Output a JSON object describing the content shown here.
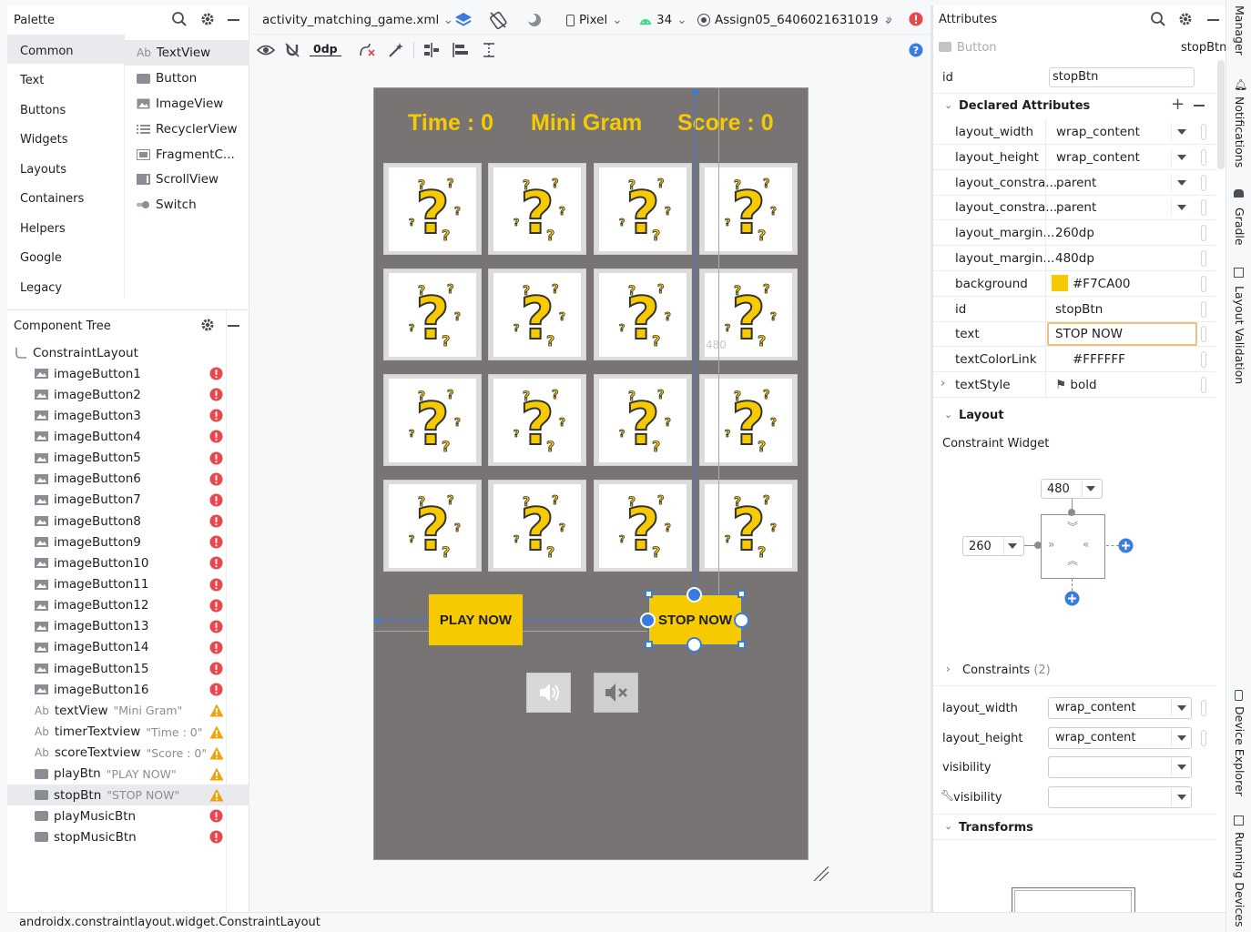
{
  "palette": {
    "title": "Palette",
    "categories": [
      "Common",
      "Text",
      "Buttons",
      "Widgets",
      "Layouts",
      "Containers",
      "Helpers",
      "Google",
      "Legacy"
    ],
    "widgets": [
      "TextView",
      "Button",
      "ImageView",
      "RecyclerView",
      "FragmentC...",
      "ScrollView",
      "Switch"
    ],
    "textview_prefix": "Ab"
  },
  "tree": {
    "title": "Component Tree",
    "root": "ConstraintLayout",
    "items": [
      {
        "name": "imageButton1",
        "sub": "",
        "badge": "error",
        "kind": "image"
      },
      {
        "name": "imageButton2",
        "sub": "",
        "badge": "error",
        "kind": "image"
      },
      {
        "name": "imageButton3",
        "sub": "",
        "badge": "error",
        "kind": "image"
      },
      {
        "name": "imageButton4",
        "sub": "",
        "badge": "error",
        "kind": "image"
      },
      {
        "name": "imageButton5",
        "sub": "",
        "badge": "error",
        "kind": "image"
      },
      {
        "name": "imageButton6",
        "sub": "",
        "badge": "error",
        "kind": "image"
      },
      {
        "name": "imageButton7",
        "sub": "",
        "badge": "error",
        "kind": "image"
      },
      {
        "name": "imageButton8",
        "sub": "",
        "badge": "error",
        "kind": "image"
      },
      {
        "name": "imageButton9",
        "sub": "",
        "badge": "error",
        "kind": "image"
      },
      {
        "name": "imageButton10",
        "sub": "",
        "badge": "error",
        "kind": "image"
      },
      {
        "name": "imageButton11",
        "sub": "",
        "badge": "error",
        "kind": "image"
      },
      {
        "name": "imageButton12",
        "sub": "",
        "badge": "error",
        "kind": "image"
      },
      {
        "name": "imageButton13",
        "sub": "",
        "badge": "error",
        "kind": "image"
      },
      {
        "name": "imageButton14",
        "sub": "",
        "badge": "error",
        "kind": "image"
      },
      {
        "name": "imageButton15",
        "sub": "",
        "badge": "error",
        "kind": "image"
      },
      {
        "name": "imageButton16",
        "sub": "",
        "badge": "error",
        "kind": "image"
      },
      {
        "name": "textView",
        "sub": "\"Mini Gram\"",
        "badge": "warning",
        "kind": "text"
      },
      {
        "name": "timerTextview",
        "sub": "\"Time : 0\"",
        "badge": "warning",
        "kind": "text"
      },
      {
        "name": "scoreTextview",
        "sub": "\"Score : 0\"",
        "badge": "warning",
        "kind": "text"
      },
      {
        "name": "playBtn",
        "sub": "\"PLAY NOW\"",
        "badge": "warning",
        "kind": "button"
      },
      {
        "name": "stopBtn",
        "sub": "\"STOP NOW\"",
        "badge": "warning",
        "kind": "button"
      },
      {
        "name": "playMusicBtn",
        "sub": "",
        "badge": "error",
        "kind": "button"
      },
      {
        "name": "stopMusicBtn",
        "sub": "",
        "badge": "error",
        "kind": "button"
      }
    ]
  },
  "toolbar": {
    "file": "activity_matching_game.xml",
    "device": "Pixel",
    "api": "34",
    "theme": "Assign05_6406021631019",
    "margin": "0dp",
    "more": "»"
  },
  "preview": {
    "time": "Time : 0",
    "title": "Mini Gram",
    "score": "Score : 0",
    "play": "PLAY NOW",
    "stop": "STOP NOW",
    "v_label": "480",
    "h_label": "260",
    "grid_rows": 4,
    "grid_cols": 4
  },
  "attributes": {
    "title": "Attributes",
    "widget_type": "Button",
    "widget_id": "stopBtn",
    "id_label": "id",
    "id_value": "stopBtn",
    "declared_title": "Declared Attributes",
    "declared": [
      {
        "k": "layout_width",
        "v": "wrap_content",
        "dd": true
      },
      {
        "k": "layout_height",
        "v": "wrap_content",
        "dd": true
      },
      {
        "k": "layout_constra...",
        "v": "parent",
        "dd": true
      },
      {
        "k": "layout_constra...",
        "v": "parent",
        "dd": true
      },
      {
        "k": "layout_margin...",
        "v": "260dp",
        "dd": false
      },
      {
        "k": "layout_margin...",
        "v": "480dp",
        "dd": false
      },
      {
        "k": "background",
        "v": "#F7CA00",
        "dd": false,
        "swatch": "#F7CA00"
      },
      {
        "k": "id",
        "v": "stopBtn",
        "dd": false
      },
      {
        "k": "text",
        "v": "STOP NOW",
        "dd": false,
        "focused": true
      },
      {
        "k": "textColorLink",
        "v": "#FFFFFF",
        "dd": false,
        "swatch": "#FFFFFF"
      },
      {
        "k": "textStyle",
        "v": "bold",
        "dd": false,
        "flag": true
      }
    ],
    "layout_title": "Layout",
    "constraint_widget": "Constraint Widget",
    "cw_top": "480",
    "cw_left": "260",
    "constraints_label": "Constraints",
    "constraints_count": "(2)",
    "layout_rows": [
      {
        "k": "layout_width",
        "v": "wrap_content"
      },
      {
        "k": "layout_height",
        "v": "wrap_content"
      },
      {
        "k": "visibility",
        "v": ""
      },
      {
        "k": "visibility",
        "v": ""
      }
    ],
    "transforms_title": "Transforms"
  },
  "strip": [
    "Manager",
    "Notifications",
    "Gradle",
    "Layout Validation",
    "Device Explorer",
    "Running Devices"
  ],
  "status": "androidx.constraintlayout.widget.ConstraintLayout",
  "colors": {
    "accent": "#F7CA00",
    "blue": "#3a7be0",
    "error": "#e5484d",
    "warning": "#f0a30a",
    "canvas": "#777473"
  }
}
